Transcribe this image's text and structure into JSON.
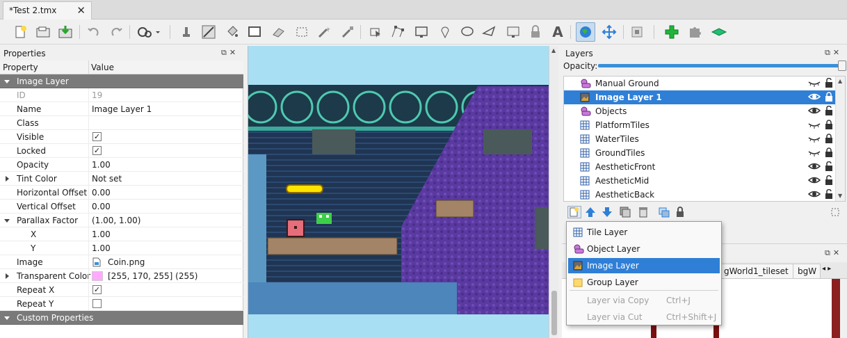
{
  "tab": {
    "title": "*Test 2.tmx",
    "close": "✕"
  },
  "toolbar": {
    "tools": [
      "new-map-icon",
      "open-icon",
      "save-icon",
      "undo-icon",
      "redo-icon",
      "commands-icon",
      "stamp-brush-icon",
      "terrain-brush-icon",
      "bucket-fill-icon",
      "shape-fill-icon",
      "eraser-icon",
      "rect-select-icon",
      "magic-wand-icon",
      "select-same-tile-icon",
      "select-objects-icon",
      "edit-polygons-icon",
      "insert-rectangle-icon",
      "insert-point-icon",
      "insert-ellipse-icon",
      "insert-polygon-icon",
      "insert-tile-icon",
      "insert-template-icon",
      "insert-text-icon",
      "world-tool-icon",
      "move-icon",
      "random-mode-icon",
      "wang-fill-icon",
      "add-icon",
      "puzzle-icon",
      "isometric-icon"
    ]
  },
  "properties": {
    "title": "Properties",
    "col_property": "Property",
    "col_value": "Value",
    "rows": [
      {
        "key": "Image Layer",
        "value": "",
        "type": "group"
      },
      {
        "key": "ID",
        "value": "19",
        "type": "readonly"
      },
      {
        "key": "Name",
        "value": "Image Layer 1",
        "type": "text"
      },
      {
        "key": "Class",
        "value": "",
        "type": "text"
      },
      {
        "key": "Visible",
        "value": "✓",
        "type": "check"
      },
      {
        "key": "Locked",
        "value": "✓",
        "type": "check"
      },
      {
        "key": "Opacity",
        "value": "1.00",
        "type": "text"
      },
      {
        "key": "Tint Color",
        "value": "Not set",
        "type": "expand"
      },
      {
        "key": "Horizontal Offset",
        "value": "0.00",
        "type": "text"
      },
      {
        "key": "Vertical Offset",
        "value": "0.00",
        "type": "text"
      },
      {
        "key": "Parallax Factor",
        "value": "(1.00, 1.00)",
        "type": "expand-open"
      },
      {
        "key": "X",
        "value": "1.00",
        "type": "sub"
      },
      {
        "key": "Y",
        "value": "1.00",
        "type": "sub"
      },
      {
        "key": "Image",
        "value": "Coin.png",
        "type": "file"
      },
      {
        "key": "Transparent Color",
        "value": "[255, 170, 255] (255)",
        "type": "color",
        "color": "#ffaaff"
      },
      {
        "key": "Repeat X",
        "value": "✓",
        "type": "check"
      },
      {
        "key": "Repeat Y",
        "value": "",
        "type": "check"
      },
      {
        "key": "Custom Properties",
        "value": "",
        "type": "group"
      }
    ]
  },
  "layers": {
    "title": "Layers",
    "opacity_label": "Opacity:",
    "opacity": 1.0,
    "items": [
      {
        "name": "Manual Ground",
        "icon": "object-layer-icon",
        "visible": false,
        "locked": false,
        "selected": false
      },
      {
        "name": "Image Layer 1",
        "icon": "image-layer-icon",
        "visible": true,
        "locked": true,
        "selected": true
      },
      {
        "name": "Objects",
        "icon": "object-layer-icon",
        "visible": true,
        "locked": false,
        "selected": false
      },
      {
        "name": "PlatformTiles",
        "icon": "tile-layer-icon",
        "visible": false,
        "locked": true,
        "selected": false
      },
      {
        "name": "WaterTiles",
        "icon": "tile-layer-icon",
        "visible": false,
        "locked": true,
        "selected": false
      },
      {
        "name": "GroundTiles",
        "icon": "tile-layer-icon",
        "visible": false,
        "locked": true,
        "selected": false
      },
      {
        "name": "AestheticFront",
        "icon": "tile-layer-icon",
        "visible": true,
        "locked": false,
        "selected": false
      },
      {
        "name": "AestheticMid",
        "icon": "tile-layer-icon",
        "visible": true,
        "locked": false,
        "selected": false
      },
      {
        "name": "AestheticBack",
        "icon": "tile-layer-icon",
        "visible": true,
        "locked": false,
        "selected": false
      }
    ]
  },
  "tilesets": {
    "tabs": [
      "gWorld1_tileset",
      "bgW"
    ]
  },
  "menu": {
    "items": [
      {
        "label": "Tile Layer",
        "icon": "tile-layer-icon",
        "shortcut": "",
        "state": "normal"
      },
      {
        "label": "Object Layer",
        "icon": "object-layer-icon",
        "shortcut": "",
        "state": "normal"
      },
      {
        "label": "Image Layer",
        "icon": "image-layer-icon",
        "shortcut": "",
        "state": "highlight"
      },
      {
        "label": "Group Layer",
        "icon": "group-layer-icon",
        "shortcut": "",
        "state": "normal"
      },
      {
        "label": "Layer via Copy",
        "icon": "",
        "shortcut": "Ctrl+J",
        "state": "disabled"
      },
      {
        "label": "Layer via Cut",
        "icon": "",
        "shortcut": "Ctrl+Shift+J",
        "state": "disabled"
      }
    ]
  },
  "colors": {
    "accent": "#2f7fd6",
    "group_row": "#7a7a7a",
    "map_sky": "#a9dff3",
    "map_wall": "#1f3553",
    "map_purple": "#5a3aa0"
  }
}
